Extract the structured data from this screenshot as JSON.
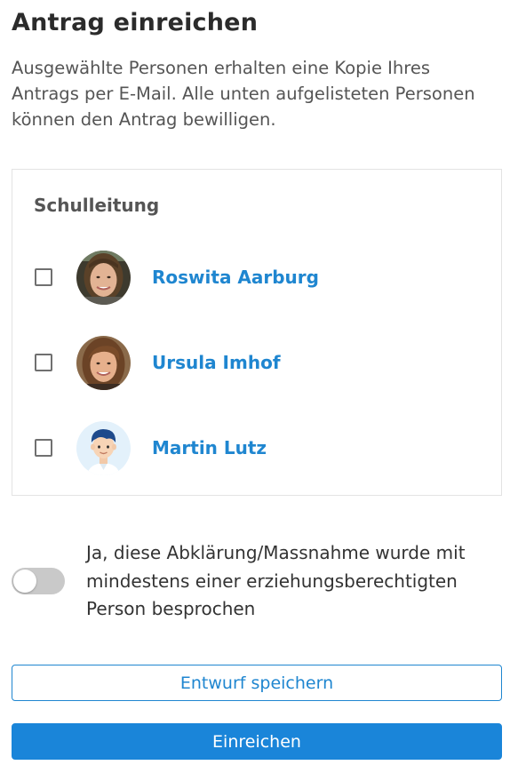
{
  "page": {
    "title": "Antrag einreichen",
    "description": "Ausgewählte Personen erhalten eine Kopie Ihres Antrags per E-Mail. Alle unten aufgelisteten Personen können den Antrag bewilligen."
  },
  "approvers": {
    "group_title": "Schulleitung",
    "people": [
      {
        "name": "Roswita Aarburg",
        "checked": false,
        "avatar": "photo-woman-icon"
      },
      {
        "name": "Ursula Imhof",
        "checked": false,
        "avatar": "photo-woman-icon"
      },
      {
        "name": "Martin Lutz",
        "checked": false,
        "avatar": "illustrated-man-icon"
      }
    ]
  },
  "consent": {
    "enabled": false,
    "label": "Ja, diese Abklärung/Massnahme wurde mit mindestens einer erziehungsberechtigten Person besprochen"
  },
  "actions": {
    "save_draft_label": "Entwurf speichern",
    "submit_label": "Einreichen"
  },
  "colors": {
    "accent": "#1f86d0",
    "primary_button": "#1a85d9",
    "toggle_off": "#c9c9c9"
  }
}
